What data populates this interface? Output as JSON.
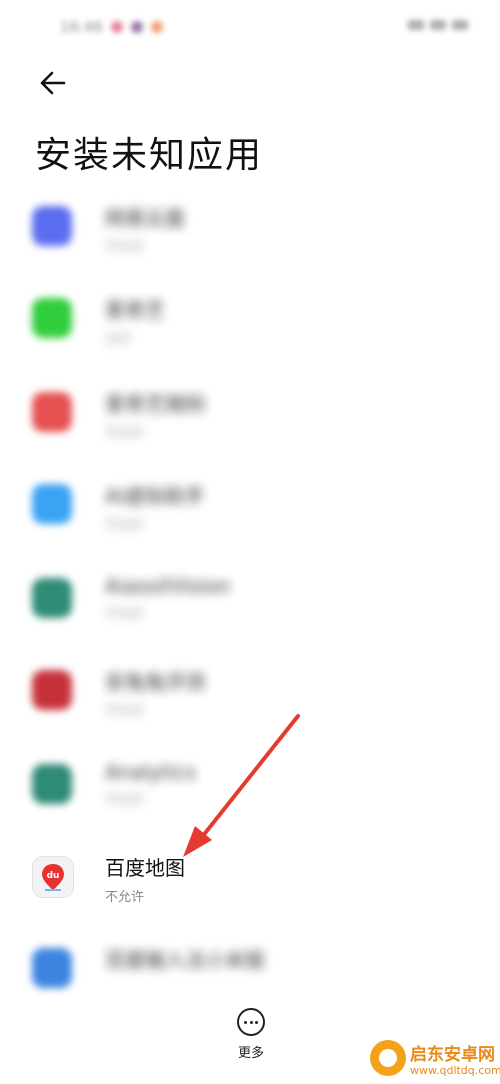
{
  "status_bar": {
    "time": "16:46",
    "icon_colors": [
      "#e05a77",
      "#7b4a8e",
      "#f07d4a"
    ]
  },
  "header": {
    "back_icon": "arrow-left-icon",
    "title": "安装未知应用"
  },
  "apps": [
    {
      "name": "网易云盘",
      "status": "不允许",
      "icon": "cloud-drive-icon",
      "color": "#5b6df0",
      "blurred": true
    },
    {
      "name": "爱奇艺",
      "status": "允许",
      "icon": "iqiyi-icon",
      "color": "#2fce3c",
      "blurred": true
    },
    {
      "name": "爱奇艺随刻",
      "status": "不允许",
      "icon": "house-icon",
      "color": "#e65151",
      "blurred": true
    },
    {
      "name": "AI虚拟助手",
      "status": "不允许",
      "icon": "assistant-icon",
      "color": "#3aa3f4",
      "blurred": true
    },
    {
      "name": "AiassitVision",
      "status": "不允许",
      "icon": "vision-icon",
      "color": "#2e8b76",
      "blurred": true
    },
    {
      "name": "安兔兔评测",
      "status": "不允许",
      "icon": "antutu-icon",
      "color": "#c7313a",
      "blurred": true
    },
    {
      "name": "Analytics",
      "status": "不允许",
      "icon": "analytics-icon",
      "color": "#2e8b76",
      "blurred": true
    },
    {
      "name": "百度地图",
      "status": "不允许",
      "icon": "baidu-map-icon",
      "color": "#e8302f",
      "blurred": false
    },
    {
      "name": "百度输入法小米版",
      "status": "",
      "icon": "baidu-input-icon",
      "color": "#3c84e0",
      "blurred": true
    }
  ],
  "footer": {
    "more_label": "更多",
    "more_icon": "more-dots-icon"
  },
  "annotation": {
    "arrow_color": "#e53a32"
  },
  "watermark": {
    "name": "启东安卓网",
    "url": "www.qdltdq.com"
  }
}
